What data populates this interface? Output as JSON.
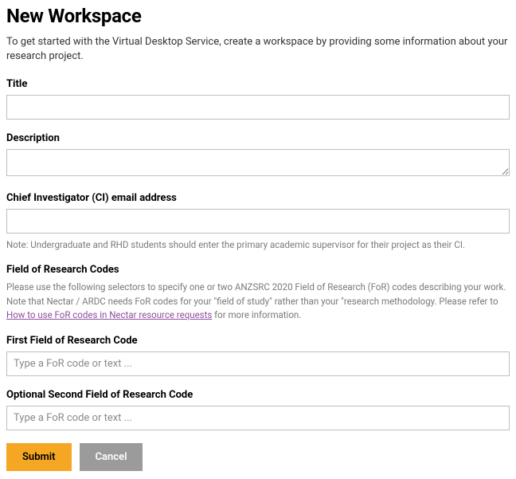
{
  "page": {
    "title": "New Workspace",
    "intro": "To get started with the Virtual Desktop Service, create a workspace by providing some information about your research project."
  },
  "form": {
    "title": {
      "label": "Title",
      "value": ""
    },
    "description": {
      "label": "Description",
      "value": ""
    },
    "ci_email": {
      "label": "Chief Investigator (CI) email address",
      "value": "",
      "note": "Note: Undergraduate and RHD students should enter the primary academic supervisor for their project as their CI."
    },
    "for_section": {
      "heading": "Field of Research Codes",
      "desc_pre": "Please use the following selectors to specify one or two ANZSRC 2020 Field of Research (FoR) codes describing your work. Note that Nectar / ARDC needs FoR codes for your \"field of study\" rather than your \"research methodology. Please refer to ",
      "desc_link": "How to use FoR codes in Nectar resource requests",
      "desc_post": " for more information."
    },
    "for1": {
      "label": "First Field of Research Code",
      "placeholder": "Type a FoR code or text ...",
      "value": ""
    },
    "for2": {
      "label": "Optional Second Field of Research Code",
      "placeholder": "Type a FoR code or text ...",
      "value": ""
    }
  },
  "buttons": {
    "submit": "Submit",
    "cancel": "Cancel"
  }
}
